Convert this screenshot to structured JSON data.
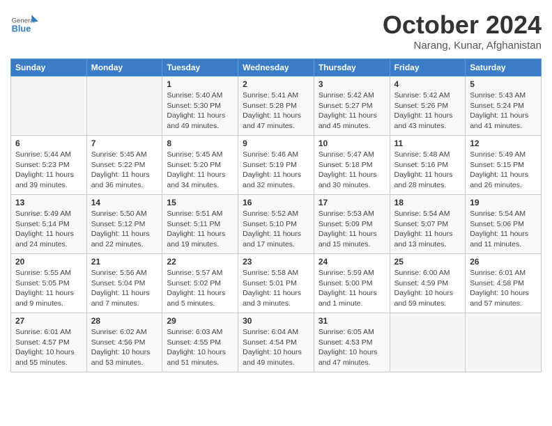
{
  "logo": {
    "general": "General",
    "blue": "Blue"
  },
  "title": "October 2024",
  "location": "Narang, Kunar, Afghanistan",
  "days_of_week": [
    "Sunday",
    "Monday",
    "Tuesday",
    "Wednesday",
    "Thursday",
    "Friday",
    "Saturday"
  ],
  "weeks": [
    [
      {
        "day": "",
        "details": ""
      },
      {
        "day": "",
        "details": ""
      },
      {
        "day": "1",
        "details": "Sunrise: 5:40 AM\nSunset: 5:30 PM\nDaylight: 11 hours and 49 minutes."
      },
      {
        "day": "2",
        "details": "Sunrise: 5:41 AM\nSunset: 5:28 PM\nDaylight: 11 hours and 47 minutes."
      },
      {
        "day": "3",
        "details": "Sunrise: 5:42 AM\nSunset: 5:27 PM\nDaylight: 11 hours and 45 minutes."
      },
      {
        "day": "4",
        "details": "Sunrise: 5:42 AM\nSunset: 5:26 PM\nDaylight: 11 hours and 43 minutes."
      },
      {
        "day": "5",
        "details": "Sunrise: 5:43 AM\nSunset: 5:24 PM\nDaylight: 11 hours and 41 minutes."
      }
    ],
    [
      {
        "day": "6",
        "details": "Sunrise: 5:44 AM\nSunset: 5:23 PM\nDaylight: 11 hours and 39 minutes."
      },
      {
        "day": "7",
        "details": "Sunrise: 5:45 AM\nSunset: 5:22 PM\nDaylight: 11 hours and 36 minutes."
      },
      {
        "day": "8",
        "details": "Sunrise: 5:45 AM\nSunset: 5:20 PM\nDaylight: 11 hours and 34 minutes."
      },
      {
        "day": "9",
        "details": "Sunrise: 5:46 AM\nSunset: 5:19 PM\nDaylight: 11 hours and 32 minutes."
      },
      {
        "day": "10",
        "details": "Sunrise: 5:47 AM\nSunset: 5:18 PM\nDaylight: 11 hours and 30 minutes."
      },
      {
        "day": "11",
        "details": "Sunrise: 5:48 AM\nSunset: 5:16 PM\nDaylight: 11 hours and 28 minutes."
      },
      {
        "day": "12",
        "details": "Sunrise: 5:49 AM\nSunset: 5:15 PM\nDaylight: 11 hours and 26 minutes."
      }
    ],
    [
      {
        "day": "13",
        "details": "Sunrise: 5:49 AM\nSunset: 5:14 PM\nDaylight: 11 hours and 24 minutes."
      },
      {
        "day": "14",
        "details": "Sunrise: 5:50 AM\nSunset: 5:12 PM\nDaylight: 11 hours and 22 minutes."
      },
      {
        "day": "15",
        "details": "Sunrise: 5:51 AM\nSunset: 5:11 PM\nDaylight: 11 hours and 19 minutes."
      },
      {
        "day": "16",
        "details": "Sunrise: 5:52 AM\nSunset: 5:10 PM\nDaylight: 11 hours and 17 minutes."
      },
      {
        "day": "17",
        "details": "Sunrise: 5:53 AM\nSunset: 5:09 PM\nDaylight: 11 hours and 15 minutes."
      },
      {
        "day": "18",
        "details": "Sunrise: 5:54 AM\nSunset: 5:07 PM\nDaylight: 11 hours and 13 minutes."
      },
      {
        "day": "19",
        "details": "Sunrise: 5:54 AM\nSunset: 5:06 PM\nDaylight: 11 hours and 11 minutes."
      }
    ],
    [
      {
        "day": "20",
        "details": "Sunrise: 5:55 AM\nSunset: 5:05 PM\nDaylight: 11 hours and 9 minutes."
      },
      {
        "day": "21",
        "details": "Sunrise: 5:56 AM\nSunset: 5:04 PM\nDaylight: 11 hours and 7 minutes."
      },
      {
        "day": "22",
        "details": "Sunrise: 5:57 AM\nSunset: 5:02 PM\nDaylight: 11 hours and 5 minutes."
      },
      {
        "day": "23",
        "details": "Sunrise: 5:58 AM\nSunset: 5:01 PM\nDaylight: 11 hours and 3 minutes."
      },
      {
        "day": "24",
        "details": "Sunrise: 5:59 AM\nSunset: 5:00 PM\nDaylight: 11 hours and 1 minute."
      },
      {
        "day": "25",
        "details": "Sunrise: 6:00 AM\nSunset: 4:59 PM\nDaylight: 10 hours and 59 minutes."
      },
      {
        "day": "26",
        "details": "Sunrise: 6:01 AM\nSunset: 4:58 PM\nDaylight: 10 hours and 57 minutes."
      }
    ],
    [
      {
        "day": "27",
        "details": "Sunrise: 6:01 AM\nSunset: 4:57 PM\nDaylight: 10 hours and 55 minutes."
      },
      {
        "day": "28",
        "details": "Sunrise: 6:02 AM\nSunset: 4:56 PM\nDaylight: 10 hours and 53 minutes."
      },
      {
        "day": "29",
        "details": "Sunrise: 6:03 AM\nSunset: 4:55 PM\nDaylight: 10 hours and 51 minutes."
      },
      {
        "day": "30",
        "details": "Sunrise: 6:04 AM\nSunset: 4:54 PM\nDaylight: 10 hours and 49 minutes."
      },
      {
        "day": "31",
        "details": "Sunrise: 6:05 AM\nSunset: 4:53 PM\nDaylight: 10 hours and 47 minutes."
      },
      {
        "day": "",
        "details": ""
      },
      {
        "day": "",
        "details": ""
      }
    ]
  ]
}
